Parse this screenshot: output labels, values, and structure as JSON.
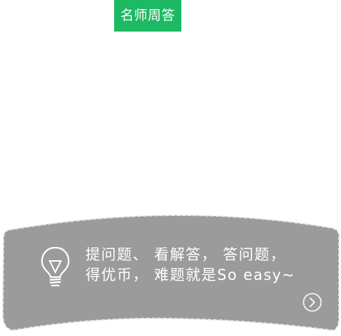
{
  "header": {
    "tab_label": "名师周答",
    "accent_color": "#1dba63"
  },
  "banner": {
    "line1": "提问题、 看解答， 答问题，",
    "line2": "得优币， 难题就是So easy~",
    "background_color": "#9b9b9b",
    "icon": "lightbulb-icon",
    "next_icon": "chevron-right-circle-icon"
  }
}
